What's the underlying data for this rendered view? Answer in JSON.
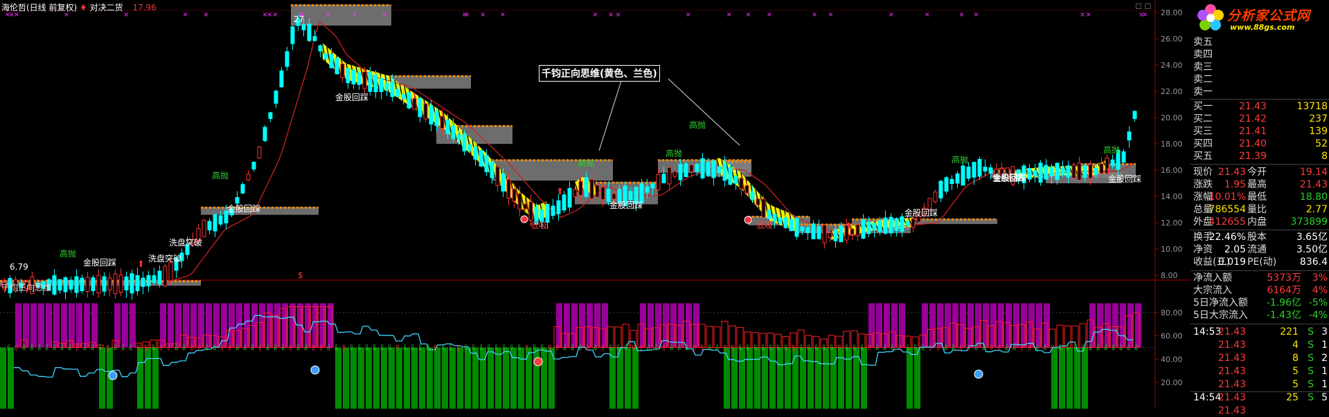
{
  "header": {
    "stock_title": "海伦哲(日线 前复权)",
    "pin_icon": "pin-icon",
    "compare_label": "对决二货",
    "price_value": "17.96",
    "window_buttons": "☐ ☐"
  },
  "indicator": {
    "title": "千钧正向思维",
    "annotation": "千钧正向思维(黄色、兰色)"
  },
  "logo": {
    "text": "分析家公式网",
    "url": "www.88gs.com",
    "icon": "flower-logo-icon"
  },
  "price_axis": [
    "28.00",
    "26.00",
    "24.00",
    "22.00",
    "20.00",
    "18.00",
    "16.00",
    "14.00",
    "12.00",
    "10.00",
    "8.00"
  ],
  "indicator_axis": [
    "80.00",
    "60.00",
    "40.00",
    "20.00"
  ],
  "main_labels": {
    "gold_return": "金股回踩",
    "high_throw": "高抛",
    "wash_break": "洗盘突破",
    "low_buy": "低吸",
    "max_marker": "27",
    "min_marker": "6.79",
    "dollar": "$"
  },
  "order_book": {
    "asks": [
      {
        "label": "卖五",
        "price": "",
        "vol": ""
      },
      {
        "label": "卖四",
        "price": "",
        "vol": ""
      },
      {
        "label": "卖三",
        "price": "",
        "vol": ""
      },
      {
        "label": "卖二",
        "price": "",
        "vol": ""
      },
      {
        "label": "卖一",
        "price": "",
        "vol": ""
      }
    ],
    "bids": [
      {
        "label": "买一",
        "price": "21.43",
        "vol": "13718"
      },
      {
        "label": "买二",
        "price": "21.42",
        "vol": "237"
      },
      {
        "label": "买三",
        "price": "21.41",
        "vol": "139"
      },
      {
        "label": "买四",
        "price": "21.40",
        "vol": "52"
      },
      {
        "label": "买五",
        "price": "21.39",
        "vol": "8"
      }
    ]
  },
  "quote": [
    {
      "l1": "现价",
      "v1": "21.43",
      "c1": "red",
      "l2": "今开",
      "v2": "19.14",
      "c2": "red"
    },
    {
      "l1": "涨跌",
      "v1": "1.95",
      "c1": "red",
      "l2": "最高",
      "v2": "21.43",
      "c2": "red"
    },
    {
      "l1": "涨幅",
      "v1": "10.01%",
      "c1": "red",
      "l2": "最低",
      "v2": "18.80",
      "c2": "green"
    },
    {
      "l1": "总量",
      "v1": "786554",
      "c1": "yellow",
      "l2": "量比",
      "v2": "2.77",
      "c2": "yellow"
    },
    {
      "l1": "外盘",
      "v1": "412655",
      "c1": "red",
      "l2": "内盘",
      "v2": "373899",
      "c2": "green"
    },
    {
      "l1": "换手",
      "v1": "22.46%",
      "c1": "white",
      "l2": "股本",
      "v2": "3.65亿",
      "c2": "white"
    },
    {
      "l1": "净资",
      "v1": "2.05",
      "c1": "white",
      "l2": "流通",
      "v2": "3.50亿",
      "c2": "white"
    },
    {
      "l1": "收益(三)",
      "v1": "0.019",
      "c1": "white",
      "l2": "PE(动)",
      "v2": "836.4",
      "c2": "white"
    }
  ],
  "flows": [
    {
      "label": "净流入额",
      "value": "5373万",
      "pct": "3%",
      "color": "red"
    },
    {
      "label": "大宗流入",
      "value": "6164万",
      "pct": "4%",
      "color": "red"
    },
    {
      "label": "5日净流入额",
      "value": "-1.96亿",
      "pct": "-5%",
      "color": "green"
    },
    {
      "label": "5日大宗流入",
      "value": "-1.43亿",
      "pct": "-4%",
      "color": "green"
    }
  ],
  "ticks": [
    {
      "time": "14:53",
      "price": "21.43",
      "vol": "221",
      "side": "S",
      "n": "3"
    },
    {
      "time": "",
      "price": "21.43",
      "vol": "4",
      "side": "S",
      "n": "1"
    },
    {
      "time": "",
      "price": "21.43",
      "vol": "8",
      "side": "S",
      "n": "2"
    },
    {
      "time": "",
      "price": "21.43",
      "vol": "5",
      "side": "S",
      "n": "1"
    },
    {
      "time": "",
      "price": "21.43",
      "vol": "5",
      "side": "S",
      "n": "1"
    },
    {
      "time": "14:54",
      "price": "21.43",
      "vol": "25",
      "side": "S",
      "n": "5"
    },
    {
      "time": "",
      "price": "21.43",
      "vol": "",
      "side": "",
      "n": ""
    }
  ],
  "colors": {
    "up": "#ff3333",
    "down": "#00ffff",
    "band": "#ffff00",
    "zone": "#808080",
    "purple": "#990099",
    "green_bar": "#008c00",
    "ma": "#cc2222"
  }
}
